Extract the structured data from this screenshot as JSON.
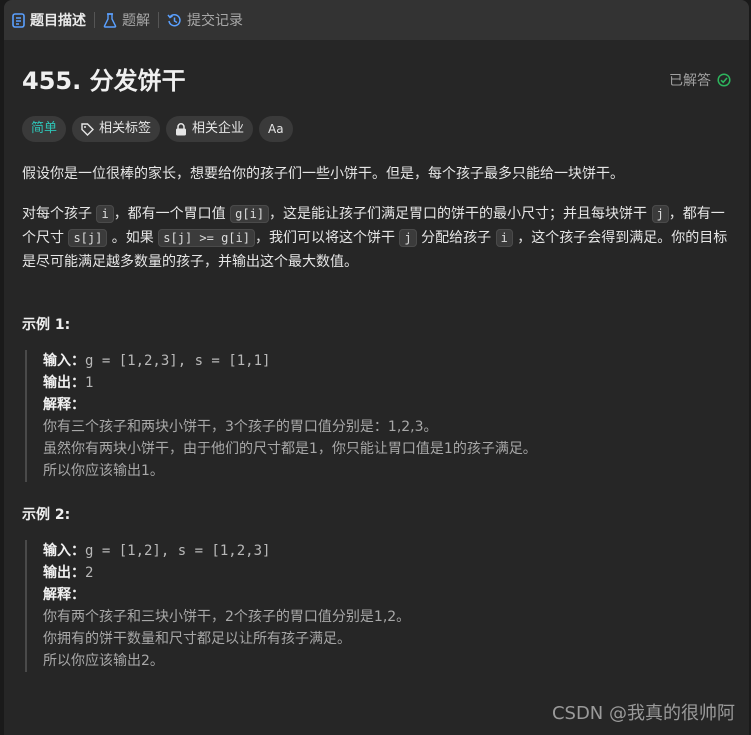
{
  "tabs": [
    {
      "label": "题目描述",
      "icon": "document-icon",
      "active": true
    },
    {
      "label": "题解",
      "icon": "flask-icon",
      "active": false
    },
    {
      "label": "提交记录",
      "icon": "history-icon",
      "active": false
    }
  ],
  "problem": {
    "title": "455. 分发饼干",
    "status": "已解答",
    "tags": [
      {
        "label": "简单",
        "icon": ""
      },
      {
        "label": "相关标签",
        "icon": "tag-icon"
      },
      {
        "label": "相关企业",
        "icon": "lock-icon"
      },
      {
        "label": "Aa",
        "icon": "translate-icon"
      }
    ],
    "intro": "假设你是一位很棒的家长，想要给你的孩子们一些小饼干。但是，每个孩子最多只能给一块饼干。",
    "body": {
      "t1": "对每个孩子 ",
      "c1": "i",
      "t2": "，都有一个胃口值 ",
      "c2": "g[i]",
      "t3": "，这是能让孩子们满足胃口的饼干的最小尺寸；并且每块饼干 ",
      "c3": "j",
      "t4": "，都有一个尺寸 ",
      "c4": "s[j]",
      "t5": " 。如果 ",
      "c5": "s[j] >= g[i]",
      "t6": "，我们可以将这个饼干 ",
      "c6": "j",
      "t7": " 分配给孩子 ",
      "c7": "i",
      "t8": " ，这个孩子会得到满足。你的目标是尽可能满足越多数量的孩子，并输出这个最大数值。"
    }
  },
  "examples": [
    {
      "title": "示例 1:",
      "input_label": "输入：",
      "input": "g = [1,2,3], s = [1,1]",
      "output_label": "输出：",
      "output": "1",
      "explain_label": "解释：",
      "explain": [
        "你有三个孩子和两块小饼干，3个孩子的胃口值分别是：1,2,3。",
        "虽然你有两块小饼干，由于他们的尺寸都是1，你只能让胃口值是1的孩子满足。",
        "所以你应该输出1。"
      ]
    },
    {
      "title": "示例 2:",
      "input_label": "输入：",
      "input": "g = [1,2], s = [1,2,3]",
      "output_label": "输出：",
      "output": "2",
      "explain_label": "解释：",
      "explain": [
        "你有两个孩子和三块小饼干，2个孩子的胃口值分别是1,2。",
        "你拥有的饼干数量和尺寸都足以让所有孩子满足。",
        "所以你应该输出2。"
      ]
    }
  ],
  "watermark": "CSDN @我真的很帅阿",
  "colors": {
    "easy": "#2ec4b6",
    "solved_check": "#2db55d",
    "background": "#262626"
  }
}
